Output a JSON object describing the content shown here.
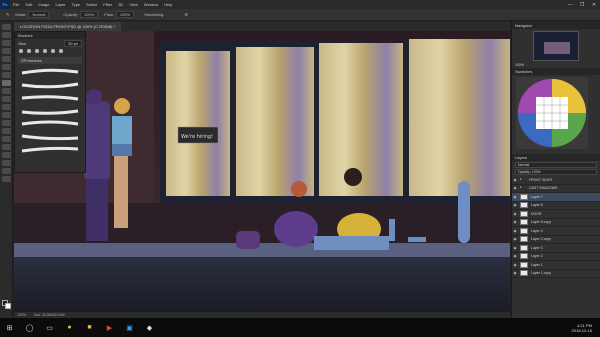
{
  "app": {
    "logo": "Ps",
    "menu": [
      "File",
      "Edit",
      "Image",
      "Layer",
      "Type",
      "Select",
      "Filter",
      "3D",
      "View",
      "Window",
      "Help"
    ],
    "window_controls": [
      "—",
      "❐",
      "✕"
    ]
  },
  "options_bar": {
    "mode_label": "Mode:",
    "mode_value": "Normal",
    "opacity_label": "Opacity:",
    "opacity_value": "100%",
    "flow_label": "Flow:",
    "flow_value": "100%",
    "smoothing_label": "Smoothing:"
  },
  "document": {
    "tab_title": "LOCATION PIZZA FRONT.PSD @ 100% (C RGB/8) *"
  },
  "brushes_panel": {
    "title": "Brushes",
    "size_label": "Size:",
    "size_value": "30 px",
    "folder_label": "ZR brushes"
  },
  "canvas": {
    "sign_text": "We're hiring!"
  },
  "status": {
    "zoom": "100%",
    "doc_info": "Doc: 32.5M/324.5M"
  },
  "navigator": {
    "title": "Navigator",
    "zoom_value": "100%"
  },
  "color_panel": {
    "title": "Swatches"
  },
  "layers": {
    "title": "Layers",
    "blend_mode": "Normal",
    "opacity_label": "Opacity: 100%",
    "rows": [
      {
        "name": "FRONT SIGHT",
        "type": "folder"
      },
      {
        "name": "CAST SHADOWS",
        "type": "folder"
      },
      {
        "name": "Layer 7",
        "type": "layer",
        "selected": true
      },
      {
        "name": "Layer 6",
        "type": "layer"
      },
      {
        "name": "DOOR",
        "type": "layer"
      },
      {
        "name": "Layer 5 copy",
        "type": "layer"
      },
      {
        "name": "Layer 4",
        "type": "layer"
      },
      {
        "name": "Layer 3 copy",
        "type": "layer"
      },
      {
        "name": "Layer 3",
        "type": "layer"
      },
      {
        "name": "Layer 2",
        "type": "layer"
      },
      {
        "name": "Layer 1",
        "type": "layer"
      },
      {
        "name": "Layer 1 copy",
        "type": "layer"
      }
    ]
  },
  "taskbar": {
    "time": "4:21 PM",
    "date": "2018-12-16"
  },
  "colors": {
    "accent": "#31a8ff",
    "selected_layer": "#3e4a5e"
  }
}
